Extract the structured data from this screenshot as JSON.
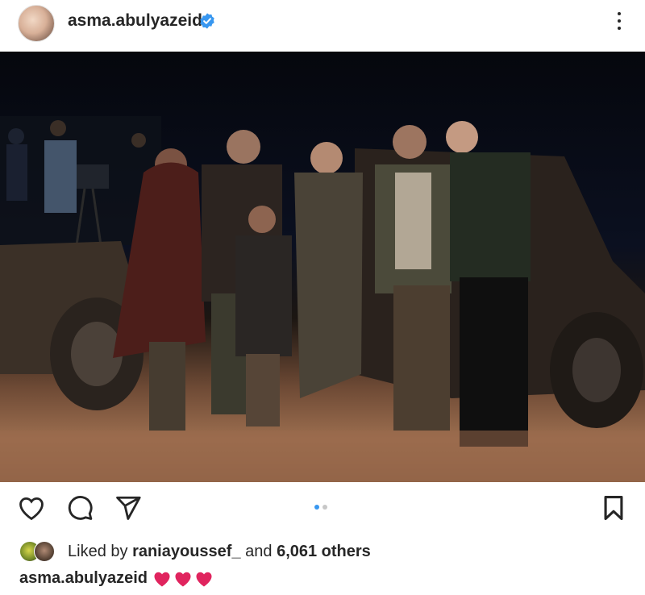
{
  "post": {
    "username": "asma.abulyazeid",
    "verified": true
  },
  "image": {
    "description_icon": "group-photo-icon"
  },
  "actions": {
    "like_icon": "heart-outline-icon",
    "comment_icon": "comment-icon",
    "share_icon": "paper-plane-icon",
    "save_icon": "bookmark-icon",
    "carousel_total": 2,
    "carousel_active_index": 0
  },
  "likes": {
    "prefix": "Liked by",
    "user": "raniayoussef_",
    "joiner": "and",
    "others": "6,061 others"
  },
  "caption": {
    "username": "asma.abulyazeid",
    "text": "❤️❤️❤️"
  },
  "colors": {
    "accent": "#3897f0",
    "heart": "#e0245e"
  }
}
